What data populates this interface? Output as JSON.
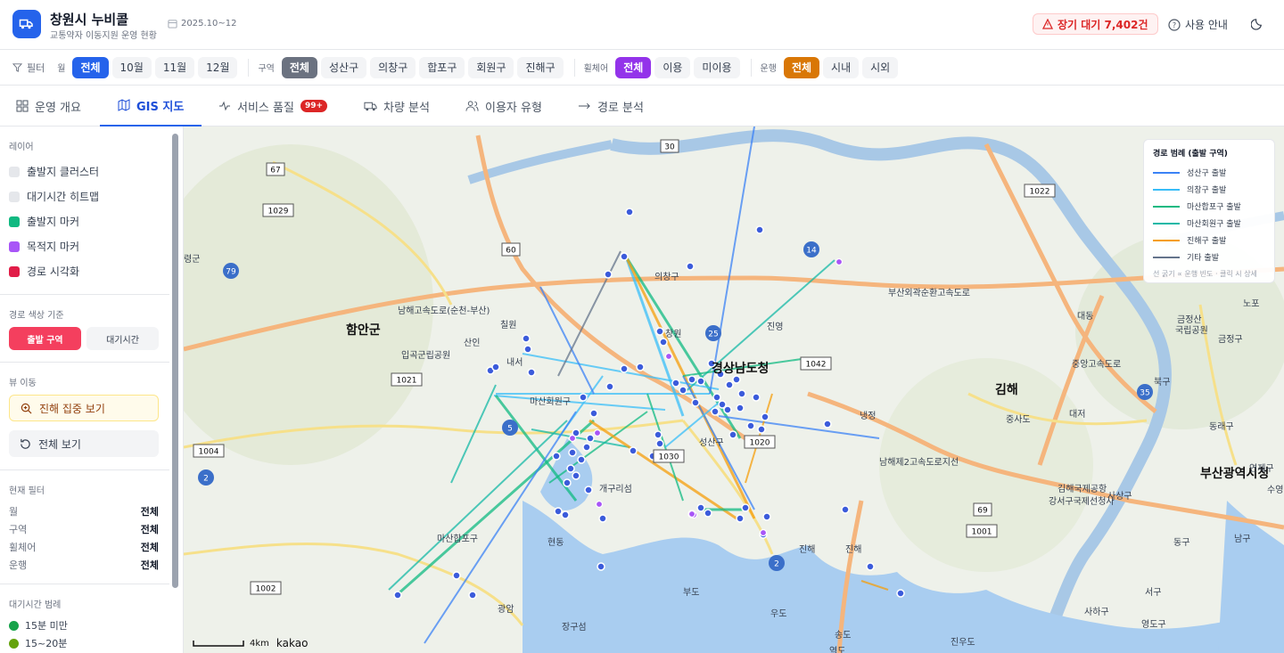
{
  "header": {
    "title": "창원시 누비콜",
    "subtitle": "교통약자 이동지원 운영 현황",
    "period": "2025.10~12",
    "alert": "장기 대기 7,402건",
    "guide": "사용 안내"
  },
  "filters": {
    "filter_label": "필터",
    "month_label": "월",
    "months": [
      "전체",
      "10월",
      "11월",
      "12월"
    ],
    "district_label": "구역",
    "districts": [
      "전체",
      "성산구",
      "의창구",
      "합포구",
      "회원구",
      "진해구"
    ],
    "wheelchair_label": "휠체어",
    "wheelchairs": [
      "전체",
      "이용",
      "미이용"
    ],
    "operation_label": "운행",
    "operations": [
      "전체",
      "시내",
      "시외"
    ]
  },
  "tabs": [
    "운영 개요",
    "GIS 지도",
    "서비스 품질",
    "차량 분석",
    "이용자 유형",
    "경로 분석"
  ],
  "tab_badge": "99+",
  "sidebar": {
    "layers_title": "레이어",
    "layers": [
      {
        "label": "출발지 클러스터",
        "color": "#e5e7eb"
      },
      {
        "label": "대기시간 히트맵",
        "color": "#e5e7eb"
      },
      {
        "label": "출발지 마커",
        "color": "#10b981"
      },
      {
        "label": "목적지 마커",
        "color": "#a855f7"
      },
      {
        "label": "경로 시각화",
        "color": "#e11d48"
      }
    ],
    "color_basis_title": "경로 색상 기준",
    "color_basis": [
      "출발 구역",
      "대기시간"
    ],
    "view_title": "뷰 이동",
    "view_jinhae": "진해 집중 보기",
    "view_all": "전체 보기",
    "current_filter_title": "현재 필터",
    "current_filters": [
      {
        "k": "월",
        "v": "전체"
      },
      {
        "k": "구역",
        "v": "전체"
      },
      {
        "k": "휠체어",
        "v": "전체"
      },
      {
        "k": "운행",
        "v": "전체"
      }
    ],
    "wait_legend_title": "대기시간 범례",
    "wait_legend": [
      {
        "label": "15분 미만",
        "color": "#16a34a"
      },
      {
        "label": "15~20분",
        "color": "#65a30d"
      }
    ]
  },
  "map": {
    "labels": [
      {
        "t": "의창구"
      },
      {
        "t": "함안군"
      },
      {
        "t": "산인"
      },
      {
        "t": "칠원"
      },
      {
        "t": "내서"
      },
      {
        "t": "마산회원구"
      },
      {
        "t": "창원"
      },
      {
        "t": "경상남도청"
      },
      {
        "t": "성산구"
      },
      {
        "t": "진영"
      },
      {
        "t": "김해"
      },
      {
        "t": "개구리섬"
      },
      {
        "t": "마산합포구"
      },
      {
        "t": "현동"
      },
      {
        "t": "광암"
      },
      {
        "t": "부도"
      },
      {
        "t": "우도"
      },
      {
        "t": "장구섬"
      },
      {
        "t": "송도"
      },
      {
        "t": "진해"
      },
      {
        "t": "냉정"
      },
      {
        "t": "중사도"
      },
      {
        "t": "대저"
      },
      {
        "t": "김해국제공항"
      },
      {
        "t": "강서구국제선청사"
      },
      {
        "t": "사상구"
      },
      {
        "t": "부산광역시청"
      },
      {
        "t": "금정산"
      },
      {
        "t": "국립공원"
      },
      {
        "t": "금정구"
      },
      {
        "t": "북구"
      },
      {
        "t": "동래구"
      },
      {
        "t": "동구"
      },
      {
        "t": "남구"
      },
      {
        "t": "서구"
      },
      {
        "t": "사하구"
      },
      {
        "t": "영도구"
      },
      {
        "t": "대동"
      },
      {
        "t": "노포"
      },
      {
        "t": "입곡군립공원"
      },
      {
        "t": "령군"
      },
      {
        "t": "남해고속도로(순천-부산)"
      },
      {
        "t": "부산외곽순환고속도로"
      },
      {
        "t": "중앙고속도로"
      },
      {
        "t": "남해제2고속도로지선"
      },
      {
        "t": "진우도"
      },
      {
        "t": "연제구"
      },
      {
        "t": "수영"
      },
      {
        "t": "진해"
      },
      {
        "t": "역도"
      }
    ],
    "route_numbers": [
      "30",
      "67",
      "1029",
      "60",
      "79",
      "14",
      "25",
      "1042",
      "1022",
      "1021",
      "5",
      "1030",
      "1004",
      "2",
      "69",
      "1001",
      "2",
      "1002",
      "35",
      "1020"
    ],
    "scale": "4km",
    "attribution": "kakao"
  },
  "legend": {
    "title": "경로 범례 (출발 구역)",
    "items": [
      {
        "label": "성산구 출발",
        "color": "#3b82f6"
      },
      {
        "label": "의창구 출발",
        "color": "#38bdf8"
      },
      {
        "label": "마산합포구 출발",
        "color": "#10b981"
      },
      {
        "label": "마산회원구 출발",
        "color": "#14b8a6"
      },
      {
        "label": "진해구 출발",
        "color": "#f59e0b"
      },
      {
        "label": "기타 출발",
        "color": "#64748b"
      }
    ],
    "note": "선 굵기 ∝ 운행 빈도 · 클릭 시 상세"
  }
}
